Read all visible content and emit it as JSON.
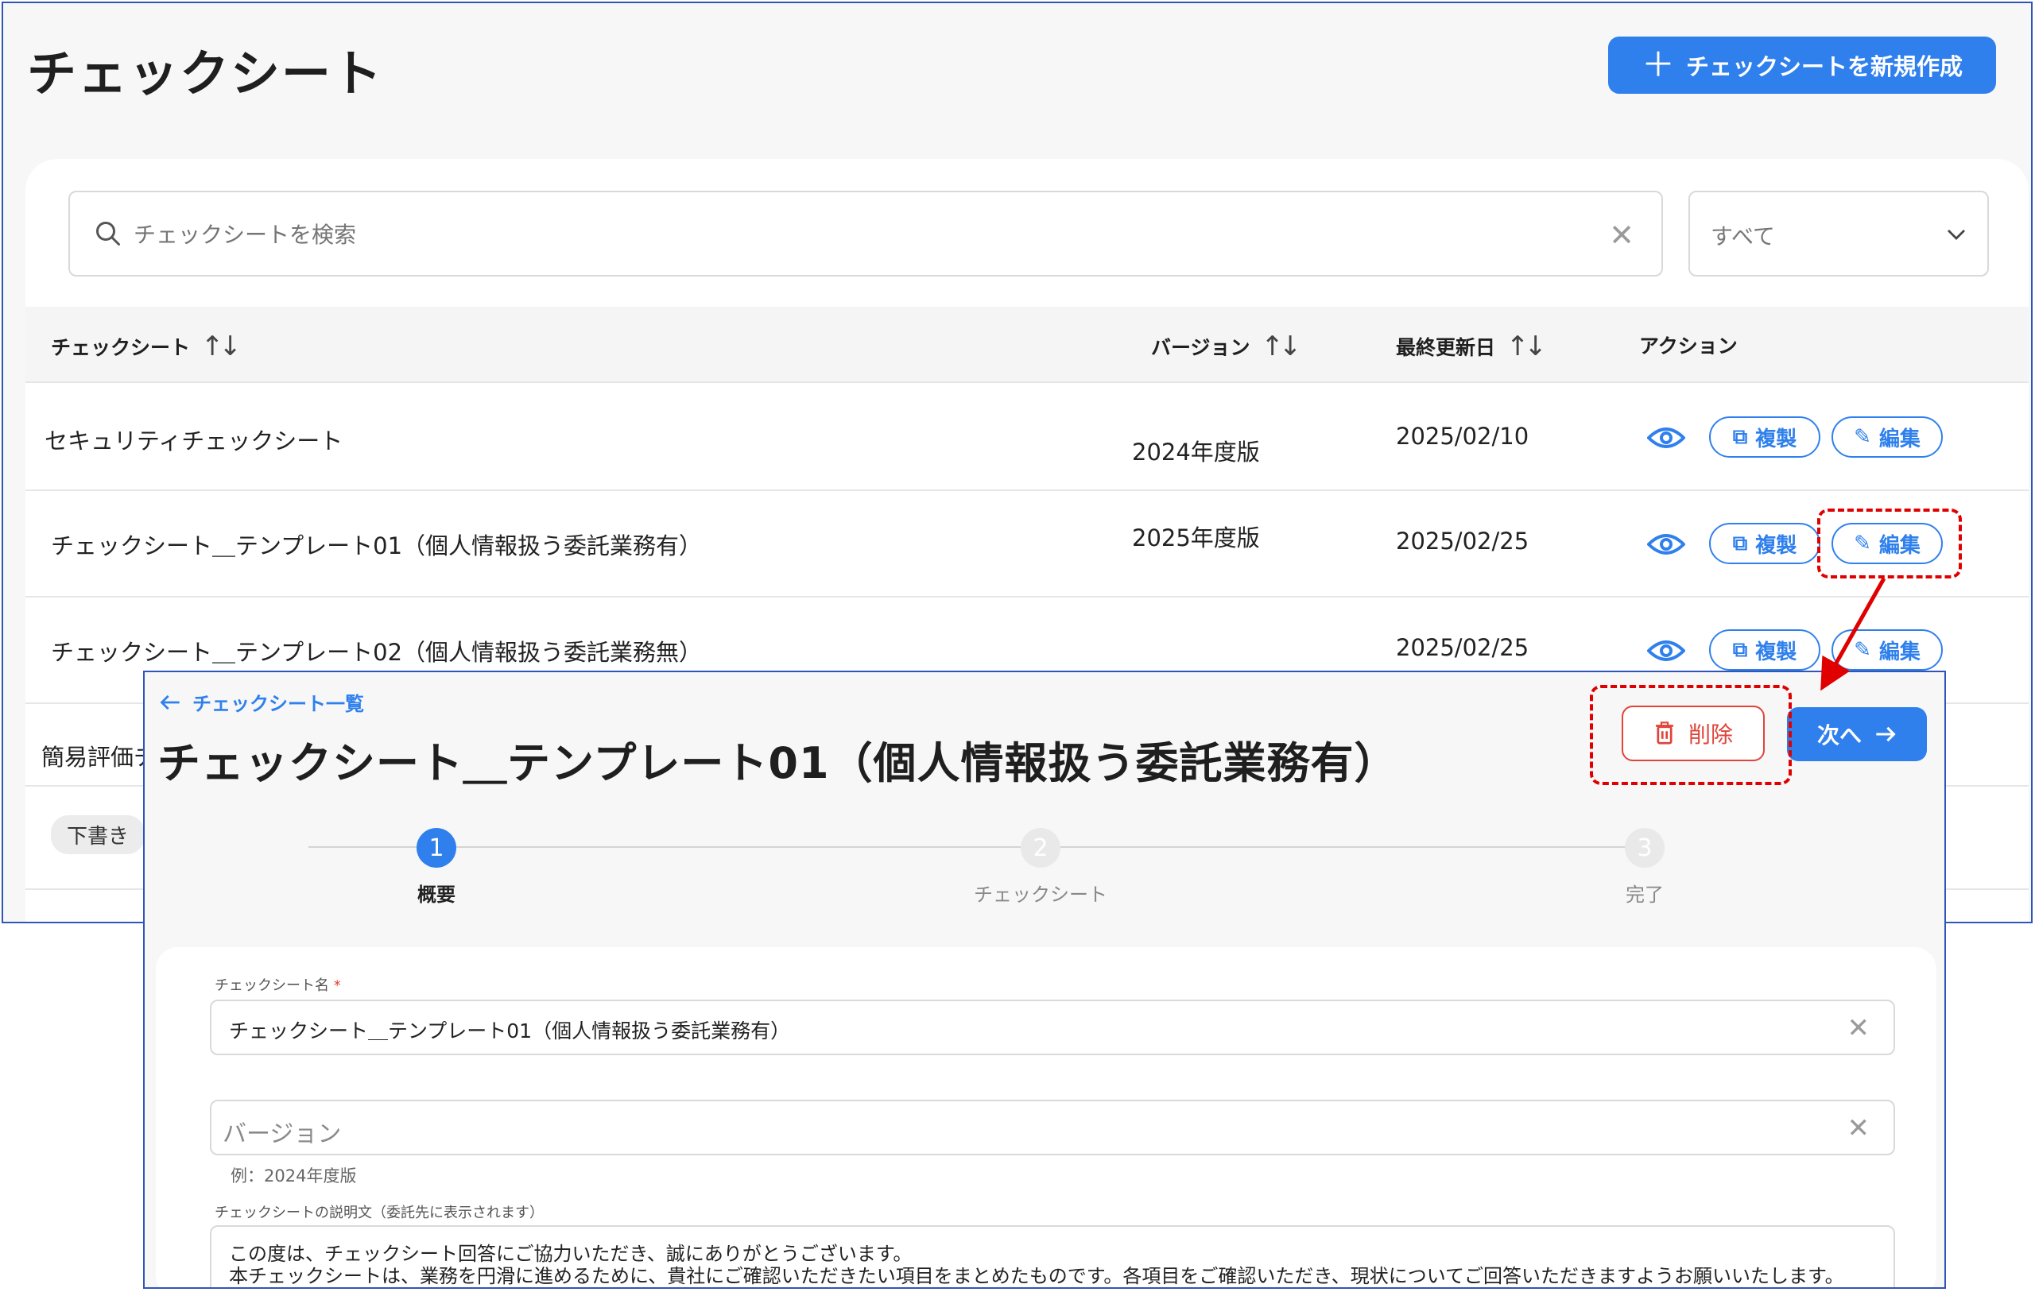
{
  "list_page": {
    "title": "チェックシート",
    "new_button": "チェックシートを新規作成",
    "search_placeholder": "チェックシートを検索",
    "filter_value": "すべて",
    "columns": {
      "name": "チェックシート",
      "version": "バージョン",
      "updated": "最終更新日",
      "actions": "アクション"
    },
    "rows": [
      {
        "name": "セキュリティチェックシート",
        "version": "2024年度版",
        "updated": "2025/02/10"
      },
      {
        "name": "チェックシート＿テンプレート01（個人情報扱う委託業務有）",
        "version": "2025年度版",
        "updated": "2025/02/25"
      },
      {
        "name": "チェックシート＿テンプレート02（個人情報扱う委託業務無）",
        "version": "",
        "updated": "2025/02/25"
      },
      {
        "name": "簡易評価チ",
        "version": "",
        "updated": ""
      },
      {
        "badge": "下書き"
      }
    ],
    "copy_label": "複製",
    "edit_label": "編集"
  },
  "edit_page": {
    "back_link": "チェックシート一覧",
    "title": "チェックシート＿テンプレート01（個人情報扱う委託業務有）",
    "delete_label": "削除",
    "next_label": "次へ",
    "steps": [
      {
        "number": "1",
        "label": "概要"
      },
      {
        "number": "2",
        "label": "チェックシート"
      },
      {
        "number": "3",
        "label": "完了"
      }
    ],
    "current_step": 1,
    "name_label": "チェックシート名",
    "required_mark": "*",
    "name_value": "チェックシート＿テンプレート01（個人情報扱う委託業務有）",
    "version_placeholder": "バージョン",
    "version_hint": "例：2024年度版",
    "desc_label": "チェックシートの説明文（委託先に表示されます）",
    "desc_line1": "この度は、チェックシート回答にご協力いただき、誠にありがとうございます。",
    "desc_line2": "本チェックシートは、業務を円滑に進めるために、貴社にご確認いただきたい項目をまとめたものです。各項目をご確認いただき、現状についてご回答いただきますようお願いいたします。"
  },
  "colors": {
    "accent": "#2f80ed",
    "danger": "#e0443a",
    "highlight": "#e00000"
  }
}
